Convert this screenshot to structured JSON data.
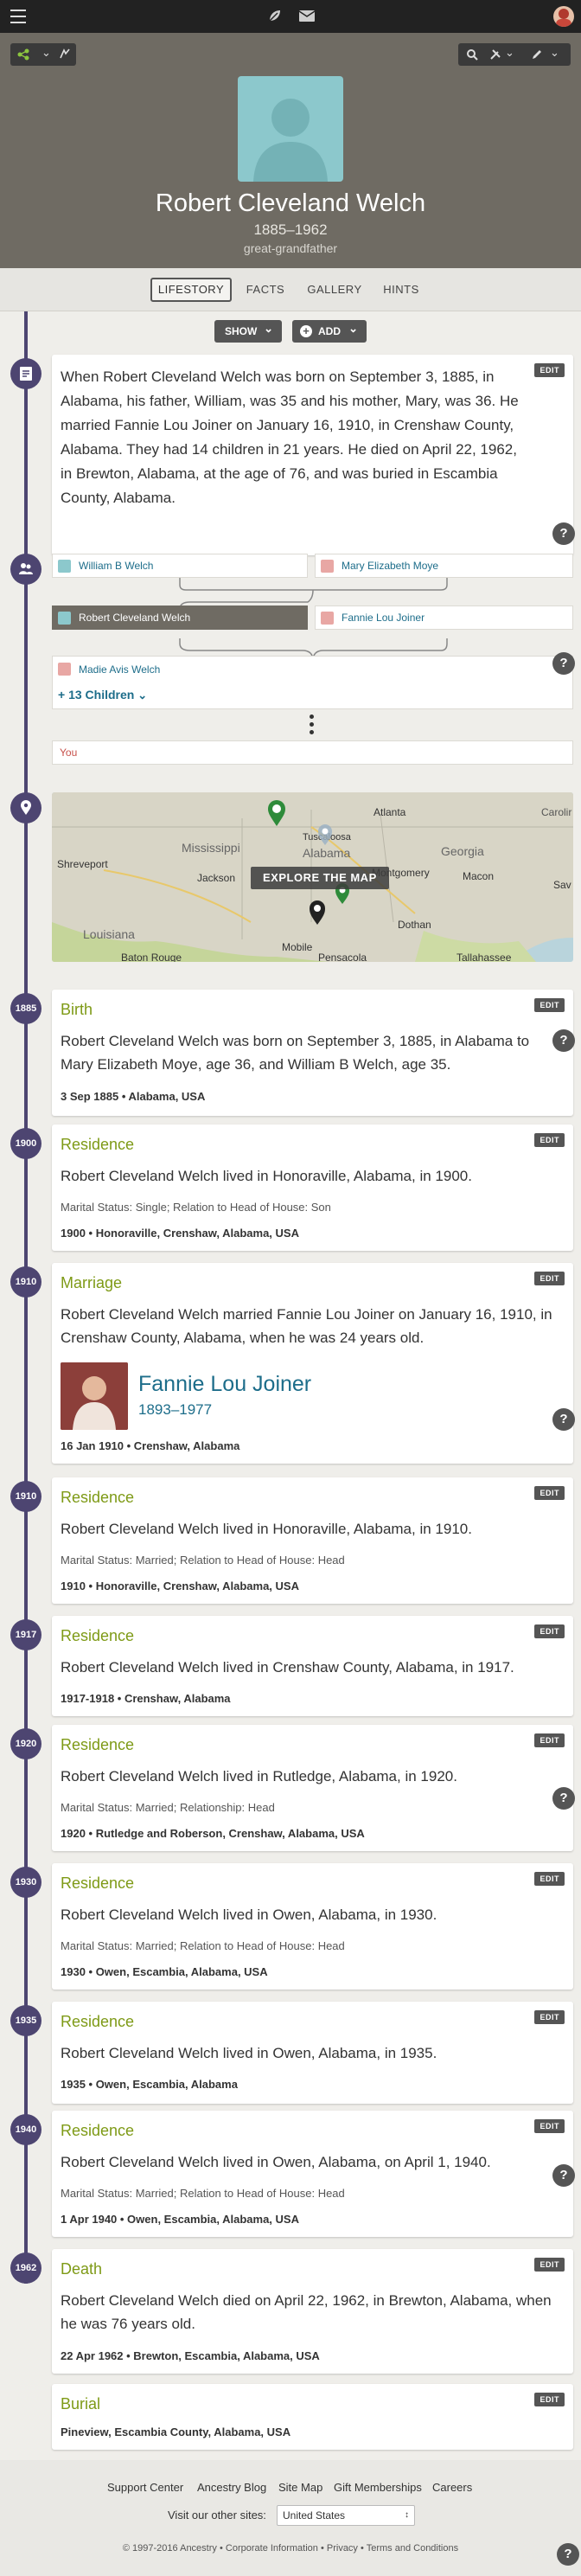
{
  "person": {
    "name": "Robert Cleveland Welch",
    "lifespan": "1885–1962",
    "relation": "great-grandfather"
  },
  "tabs": [
    {
      "label": "LIFESTORY",
      "active": true
    },
    {
      "label": "FACTS"
    },
    {
      "label": "GALLERY"
    },
    {
      "label": "HINTS"
    }
  ],
  "controls": {
    "show_label": "SHOW",
    "add_label": "ADD"
  },
  "edit_label": "EDIT",
  "help_label": "?",
  "story": {
    "text": "When Robert Cleveland Welch was born on September 3, 1885, in Alabama, his father, William, was 35 and his mother, Mary, was 36. He married Fannie Lou Joiner on January 16, 1910, in Crenshaw County, Alabama. They had 14 children in 21 years. He died on April 22, 1962, in Brewton, Alabama, at the age of 76, and was buried in Escambia County, Alabama."
  },
  "family": {
    "father": "William B Welch",
    "mother": "Mary Elizabeth Moye",
    "self": "Robert Cleveland Welch",
    "spouse": "Fannie Lou Joiner",
    "child": "Madie Avis Welch",
    "more_children": "+ 13 Children",
    "you": "You"
  },
  "map": {
    "button": "EXPLORE THE MAP",
    "places": [
      "Atlanta",
      "Carolir",
      "Shreveport",
      "Mississippi",
      "Tuscaloosa",
      "Alabama",
      "Jackson",
      "Montgomery",
      "Georgia",
      "Macon",
      "Sav",
      "Louisiana",
      "Dothan",
      "Baton Rouge",
      "Mobile",
      "Pensacola",
      "Tallahassee"
    ]
  },
  "events": [
    {
      "year": "1885",
      "title": "Birth",
      "text": "Robert Cleveland Welch was born on September 3, 1885, in Alabama to Mary Elizabeth Moye, age 36, and William B Welch, age 35.",
      "meta": "3 Sep 1885 • Alabama, USA"
    },
    {
      "year": "1900",
      "title": "Residence",
      "text": "Robert Cleveland Welch lived in Honoraville, Alabama, in 1900.",
      "detail": "Marital Status: Single; Relation to Head of House: Son",
      "meta": "1900 • Honoraville, Crenshaw, Alabama, USA"
    },
    {
      "year": "1910",
      "title": "Marriage",
      "text": "Robert Cleveland Welch married Fannie Lou Joiner on January 16, 1910, in Crenshaw County, Alabama, when he was 24 years old.",
      "spouse_name": "Fannie Lou Joiner",
      "spouse_dates": "1893–1977",
      "meta": "16 Jan 1910 • Crenshaw, Alabama"
    },
    {
      "year": "1910",
      "title": "Residence",
      "text": "Robert Cleveland Welch lived in Honoraville, Alabama, in 1910.",
      "detail": "Marital Status: Married; Relation to Head of House: Head",
      "meta": "1910 • Honoraville, Crenshaw, Alabama, USA"
    },
    {
      "year": "1917",
      "title": "Residence",
      "text": "Robert Cleveland Welch lived in Crenshaw County, Alabama, in 1917.",
      "meta": "1917-1918 • Crenshaw, Alabama"
    },
    {
      "year": "1920",
      "title": "Residence",
      "text": "Robert Cleveland Welch lived in Rutledge, Alabama, in 1920.",
      "detail": "Marital Status: Married; Relationship: Head",
      "meta": "1920 • Rutledge and Roberson, Crenshaw, Alabama, USA"
    },
    {
      "year": "1930",
      "title": "Residence",
      "text": "Robert Cleveland Welch lived in Owen, Alabama, in 1930.",
      "detail": "Marital Status: Married; Relation to Head of House: Head",
      "meta": "1930 • Owen, Escambia, Alabama, USA"
    },
    {
      "year": "1935",
      "title": "Residence",
      "text": "Robert Cleveland Welch lived in Owen, Alabama, in 1935.",
      "meta": "1935 • Owen, Escambia, Alabama"
    },
    {
      "year": "1940",
      "title": "Residence",
      "text": "Robert Cleveland Welch lived in Owen, Alabama, on April 1, 1940.",
      "detail": "Marital Status: Married; Relation to Head of House: Head",
      "meta": "1 Apr 1940 • Owen, Escambia, Alabama, USA"
    },
    {
      "year": "1962",
      "title": "Death",
      "text": "Robert Cleveland Welch died on April 22, 1962, in Brewton, Alabama, when he was 76 years old.",
      "meta": "22 Apr 1962 • Brewton, Escambia, Alabama, USA"
    },
    {
      "title": "Burial",
      "meta": "Pineview, Escambia County, Alabama, USA"
    }
  ],
  "footer": {
    "links": [
      "Support Center",
      "Ancestry Blog",
      "Site Map",
      "Gift Memberships",
      "Careers"
    ],
    "visit_label": "Visit our other sites:",
    "site_select": "United States",
    "copyright": "© 1997-2016 Ancestry",
    "bottom_links": [
      "Corporate Information",
      "Privacy",
      "Terms and Conditions"
    ]
  },
  "colors": {
    "accent": "#4d4571",
    "event_title": "#7e9a16",
    "link": "#1d6d8a"
  }
}
